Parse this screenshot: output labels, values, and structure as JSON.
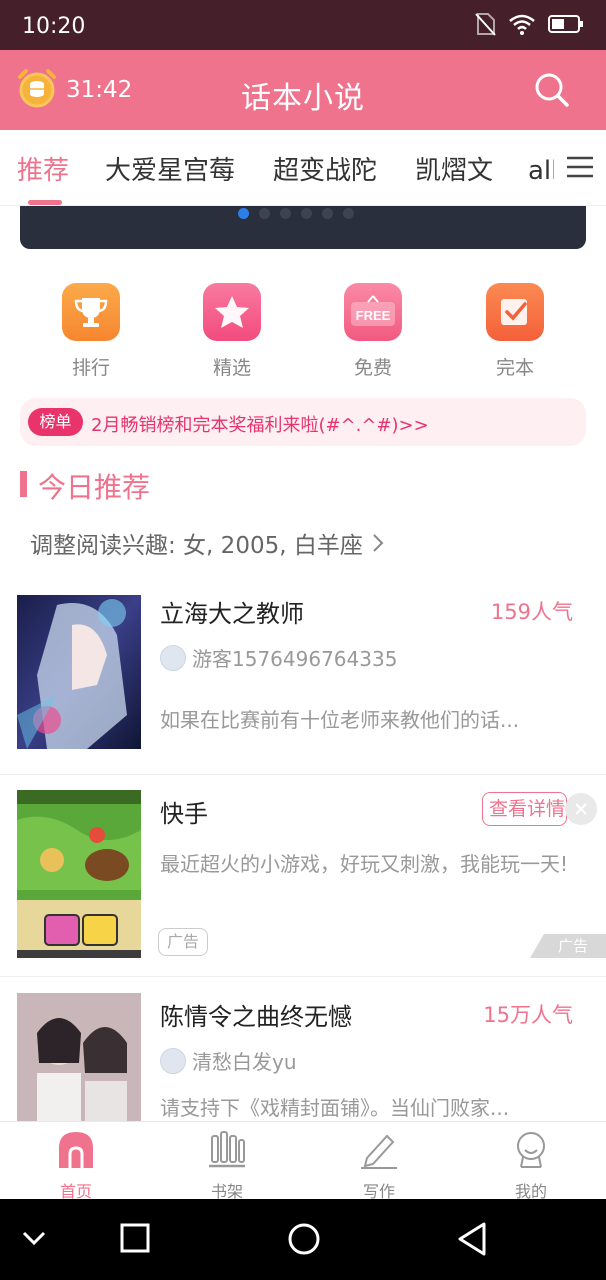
{
  "status_bar": {
    "time": "10:20"
  },
  "app_bar": {
    "timer": "31:42",
    "title": "话本小说"
  },
  "tabs": [
    {
      "label": "推荐",
      "active": true
    },
    {
      "label": "大爱星宫莓",
      "active": false
    },
    {
      "label": "超变战陀",
      "active": false
    },
    {
      "label": "凯熠文",
      "active": false
    },
    {
      "label": "all四",
      "active": false
    }
  ],
  "quick_links": [
    {
      "label": "排行",
      "icon": "trophy-icon",
      "color": "#f8923a"
    },
    {
      "label": "精选",
      "icon": "star-icon",
      "color": "#f55c8a"
    },
    {
      "label": "免费",
      "icon": "free-icon",
      "icon_text": "FREE",
      "color": "#f46a8e"
    },
    {
      "label": "完本",
      "icon": "check-icon",
      "color": "#f7683c"
    }
  ],
  "notice": {
    "tag": "榜单",
    "message": "2月畅销榜和完本奖福利来啦(#^.^#)>>"
  },
  "section": {
    "title": "今日推荐"
  },
  "interest": {
    "text": "调整阅读兴趣: 女, 2005, 白羊座"
  },
  "books": [
    {
      "title": "立海大之教师",
      "popularity": "159人气",
      "author": "游客1576496764335",
      "desc": "如果在比赛前有十位老师来教他们的话..."
    },
    {
      "title": "陈情令之曲终无憾",
      "popularity": "15万人气",
      "author": "清愁白发yu",
      "desc": "请支持下《戏精封面铺》。当仙门败家..."
    }
  ],
  "ad": {
    "title": "快手",
    "button": "查看详情",
    "desc": "最近超火的小游戏，好玩又刺激，我能玩一天!",
    "tag": "广告",
    "corner": "广告"
  },
  "bottom_nav": [
    {
      "label": "首页",
      "active": true
    },
    {
      "label": "书架",
      "active": false
    },
    {
      "label": "写作",
      "active": false
    },
    {
      "label": "我的",
      "active": false
    }
  ],
  "colors": {
    "accent": "#f0738d",
    "status_bar": "#45202a",
    "notice_red": "#e9336b"
  }
}
